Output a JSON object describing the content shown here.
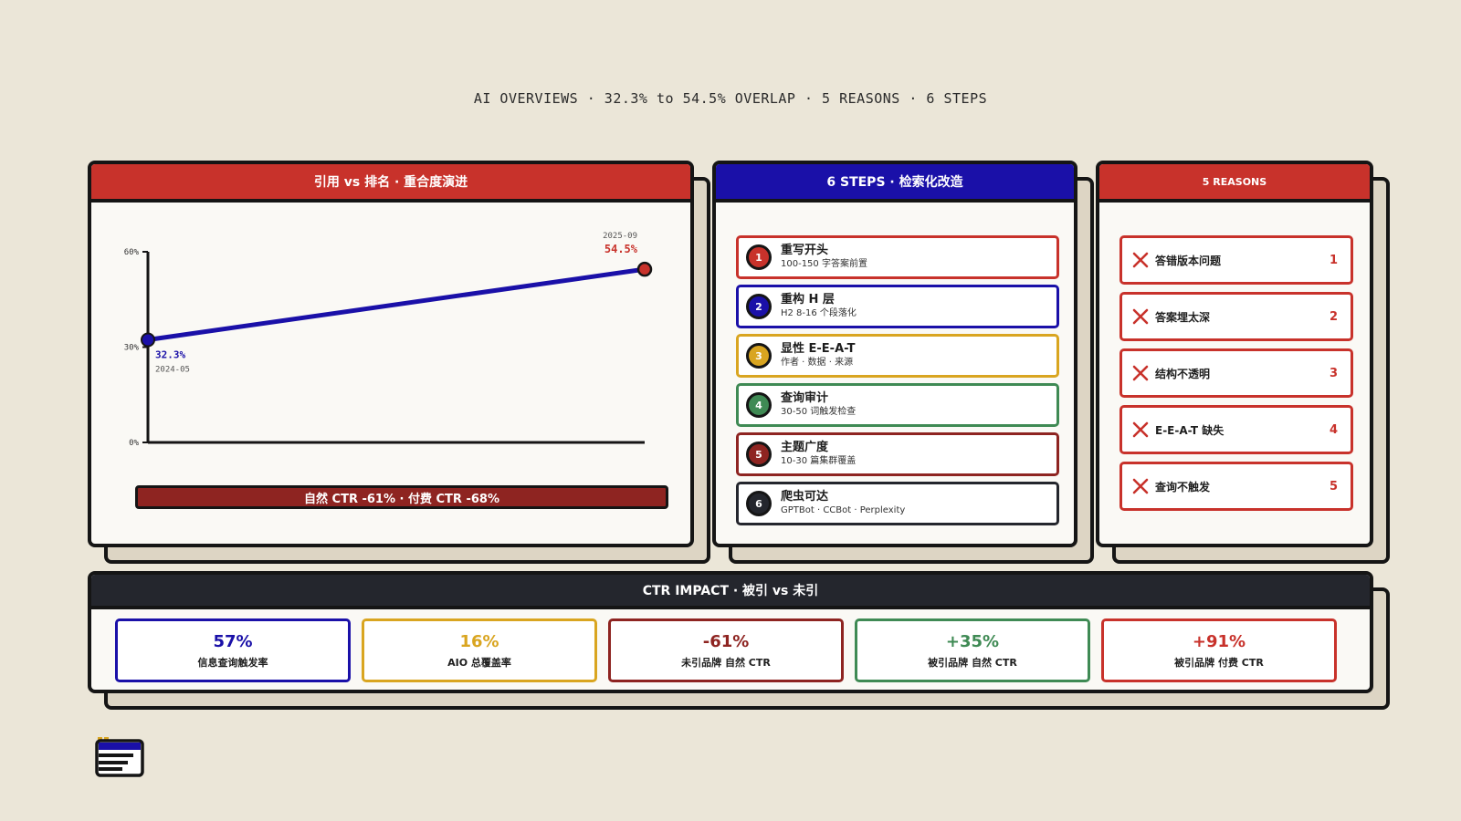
{
  "page": {
    "title": "AI OVERVIEWS · 32.3% to 54.5% OVERLAP · 5 REASONS · 6 STEPS"
  },
  "chart_panel": {
    "header": "引用 vs 排名 · 重合度演进",
    "ctr_bar": "自然 CTR -61% · 付费 CTR -68%"
  },
  "chart_data": {
    "type": "line",
    "x": [
      "2024-05",
      "2025-09"
    ],
    "values": [
      32.3,
      54.5
    ],
    "point_labels": [
      "32.3%",
      "54.5%"
    ],
    "date_labels": [
      "2024-05",
      "2025-09"
    ],
    "y_ticks": [
      "60%",
      "30%",
      "0%"
    ],
    "ylim": [
      0,
      60
    ],
    "colors": {
      "line": "#1a10a8",
      "start_point": "#1a10a8",
      "end_point": "#c8322b"
    }
  },
  "steps_panel": {
    "header": "6 STEPS · 检索化改造",
    "steps": [
      {
        "num": "1",
        "title": "重写开头",
        "sub": "100-150 字答案前置",
        "color": "#c8322b"
      },
      {
        "num": "2",
        "title": "重构 H 层",
        "sub": "H2 8-16 个段落化",
        "color": "#1a10a8"
      },
      {
        "num": "3",
        "title": "显性 E-E-A-T",
        "sub": "作者 · 数据 · 来源",
        "color": "#d9a520"
      },
      {
        "num": "4",
        "title": "查询审计",
        "sub": "30-50 词触发检查",
        "color": "#3f8a54"
      },
      {
        "num": "5",
        "title": "主题广度",
        "sub": "10-30 篇集群覆盖",
        "color": "#8e2421"
      },
      {
        "num": "6",
        "title": "爬虫可达",
        "sub": "GPTBot · CCBot · Perplexity",
        "color": "#24262d"
      }
    ]
  },
  "reasons_panel": {
    "header": "5 REASONS",
    "reasons": [
      {
        "label": "答错版本问题",
        "num": "1"
      },
      {
        "label": "答案埋太深",
        "num": "2"
      },
      {
        "label": "结构不透明",
        "num": "3"
      },
      {
        "label": "E-E-A-T 缺失",
        "num": "4"
      },
      {
        "label": "查询不触发",
        "num": "5"
      }
    ]
  },
  "ctr_panel": {
    "header": "CTR IMPACT · 被引 vs 未引",
    "metrics": [
      {
        "value": "57%",
        "label": "信息查询触发率",
        "color": "#1a10a8"
      },
      {
        "value": "16%",
        "label": "AIO 总覆盖率",
        "color": "#d9a520"
      },
      {
        "value": "-61%",
        "label": "未引品牌 自然 CTR",
        "color": "#8e2421"
      },
      {
        "value": "+35%",
        "label": "被引品牌 自然 CTR",
        "color": "#3f8a54"
      },
      {
        "value": "+91%",
        "label": "被引品牌 付费 CTR",
        "color": "#c8322b"
      }
    ]
  },
  "logo": {
    "icon": "browser-window-icon"
  }
}
